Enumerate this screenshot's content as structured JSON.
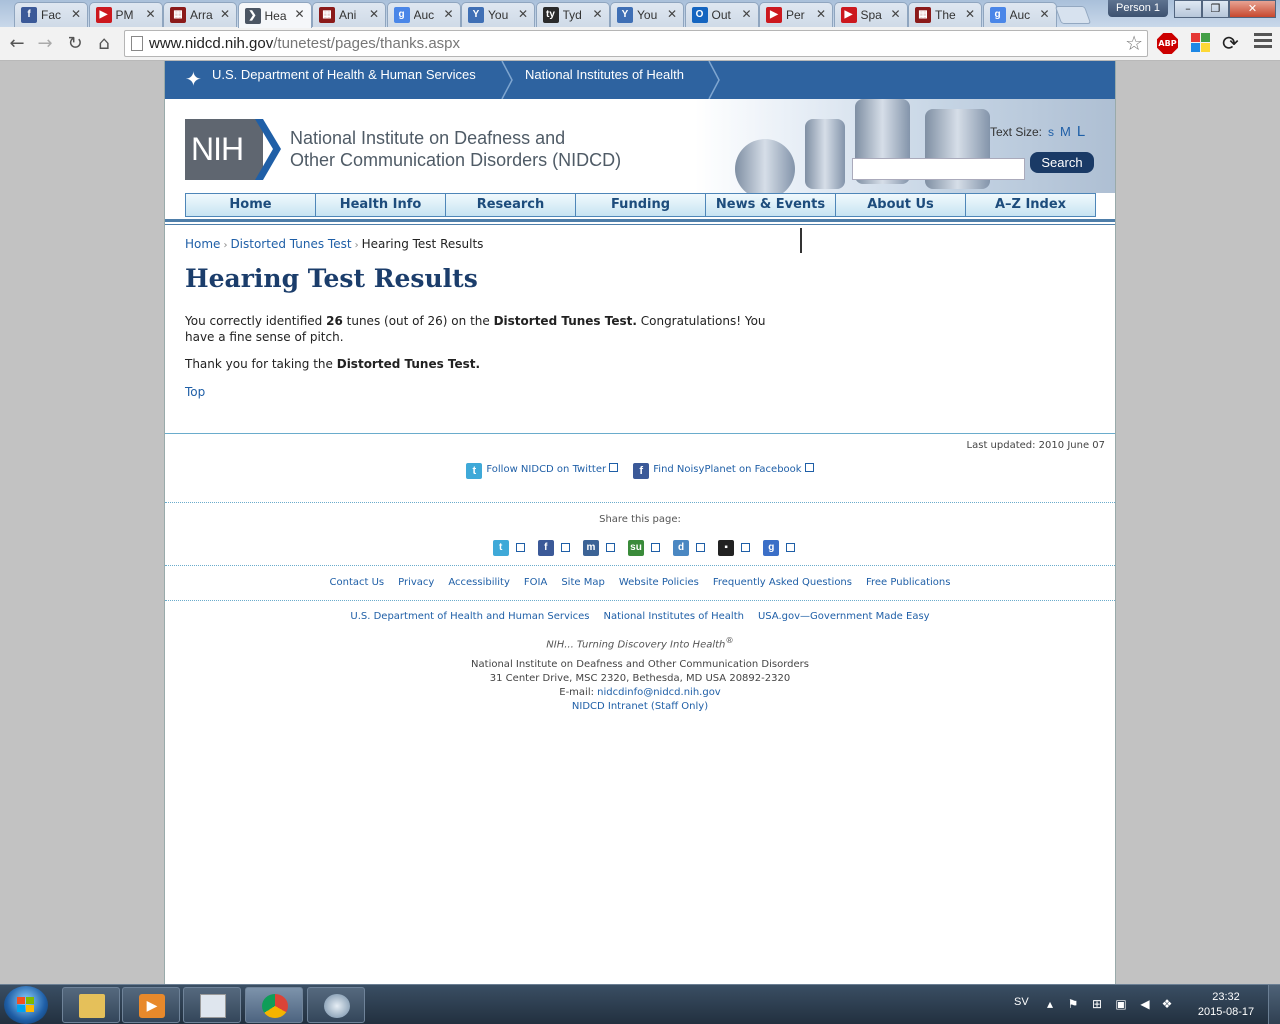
{
  "browser": {
    "tabs": [
      {
        "title": "Fac",
        "icon": "facebook-icon",
        "color": "#3b5998",
        "glyph": "f"
      },
      {
        "title": "PM",
        "icon": "youtube-icon",
        "color": "#cc181e",
        "glyph": "▶"
      },
      {
        "title": "Arra",
        "icon": "site-icon",
        "color": "#8b1a1a",
        "glyph": "▦"
      },
      {
        "title": "Hea",
        "icon": "nih-icon",
        "color": "#4b5563",
        "glyph": "❯",
        "active": true
      },
      {
        "title": "Ani",
        "icon": "site-icon",
        "color": "#8b1a1a",
        "glyph": "▦"
      },
      {
        "title": "Auc",
        "icon": "google-icon",
        "color": "#4a86e8",
        "glyph": "g"
      },
      {
        "title": "You",
        "icon": "mp3-icon",
        "color": "#3f6fb5",
        "glyph": "Y"
      },
      {
        "title": "Tyd",
        "icon": "ty-icon",
        "color": "#2a2a2a",
        "glyph": "ty"
      },
      {
        "title": "You",
        "icon": "mp3-icon",
        "color": "#3f6fb5",
        "glyph": "Y"
      },
      {
        "title": "Out",
        "icon": "outlook-icon",
        "color": "#1565c0",
        "glyph": "O"
      },
      {
        "title": "Per",
        "icon": "youtube-icon",
        "color": "#cc181e",
        "glyph": "▶"
      },
      {
        "title": "Spa",
        "icon": "youtube-icon",
        "color": "#cc181e",
        "glyph": "▶"
      },
      {
        "title": "The",
        "icon": "site-icon",
        "color": "#8b1a1a",
        "glyph": "▦"
      },
      {
        "title": "Auc",
        "icon": "google-icon",
        "color": "#4a86e8",
        "glyph": "g"
      }
    ],
    "profile": "Person 1",
    "url_host": "www.nidcd.nih.gov",
    "url_path": "/tunetest/pages/thanks.aspx",
    "abp_label": "ABP"
  },
  "site": {
    "hhs_link": "U.S. Department of Health & Human Services",
    "nih_link": "National Institutes of Health",
    "logo_text": "NIH",
    "institute_line1": "National Institute on Deafness and",
    "institute_line2": "Other Communication Disorders (NIDCD)",
    "text_size_label": "Text Size:",
    "text_sizes": [
      "s",
      "M",
      "L"
    ],
    "search_button": "Search",
    "nav": [
      "Home",
      "Health Info",
      "Research",
      "Funding",
      "News & Events",
      "About Us",
      "A–Z Index"
    ]
  },
  "breadcrumb": {
    "home": "Home",
    "parent": "Distorted Tunes Test",
    "current": "Hearing Test Results",
    "separator": "›"
  },
  "content": {
    "title": "Hearing Test Results",
    "result_pre": "You correctly identified ",
    "score": "26",
    "result_mid": " tunes (out of 26) on the ",
    "test_name": "Distorted Tunes Test.",
    "result_post": " Congratulations! You have a fine sense of pitch.",
    "thanks_pre": "Thank you for taking the ",
    "thanks_test": "Distorted Tunes Test.",
    "top_link": "Top"
  },
  "footer": {
    "last_updated": "Last updated: 2010 June 07",
    "twitter": "Follow NIDCD on Twitter",
    "facebook": "Find NoisyPlanet on Facebook",
    "share_label": "Share this page:",
    "links": [
      "Contact Us",
      "Privacy",
      "Accessibility",
      "FOIA",
      "Site Map",
      "Website Policies",
      "Frequently Asked Questions",
      "Free Publications"
    ],
    "gov_links": [
      "U.S. Department of Health and Human Services",
      "National Institutes of Health",
      "USA.gov—Government Made Easy"
    ],
    "tagline": "NIH... Turning Discovery Into Health",
    "tagline_mark": "®",
    "address_line1": "National Institute on Deafness and Other Communication Disorders",
    "address_line2": "31 Center Drive, MSC 2320, Bethesda, MD USA 20892-2320",
    "email_label": "E-mail: ",
    "email": "nidcdinfo@nidcd.nih.gov",
    "intranet": "NIDCD Intranet (Staff Only)"
  },
  "taskbar": {
    "language": "SV",
    "time": "23:32",
    "date": "2015-08-17"
  }
}
